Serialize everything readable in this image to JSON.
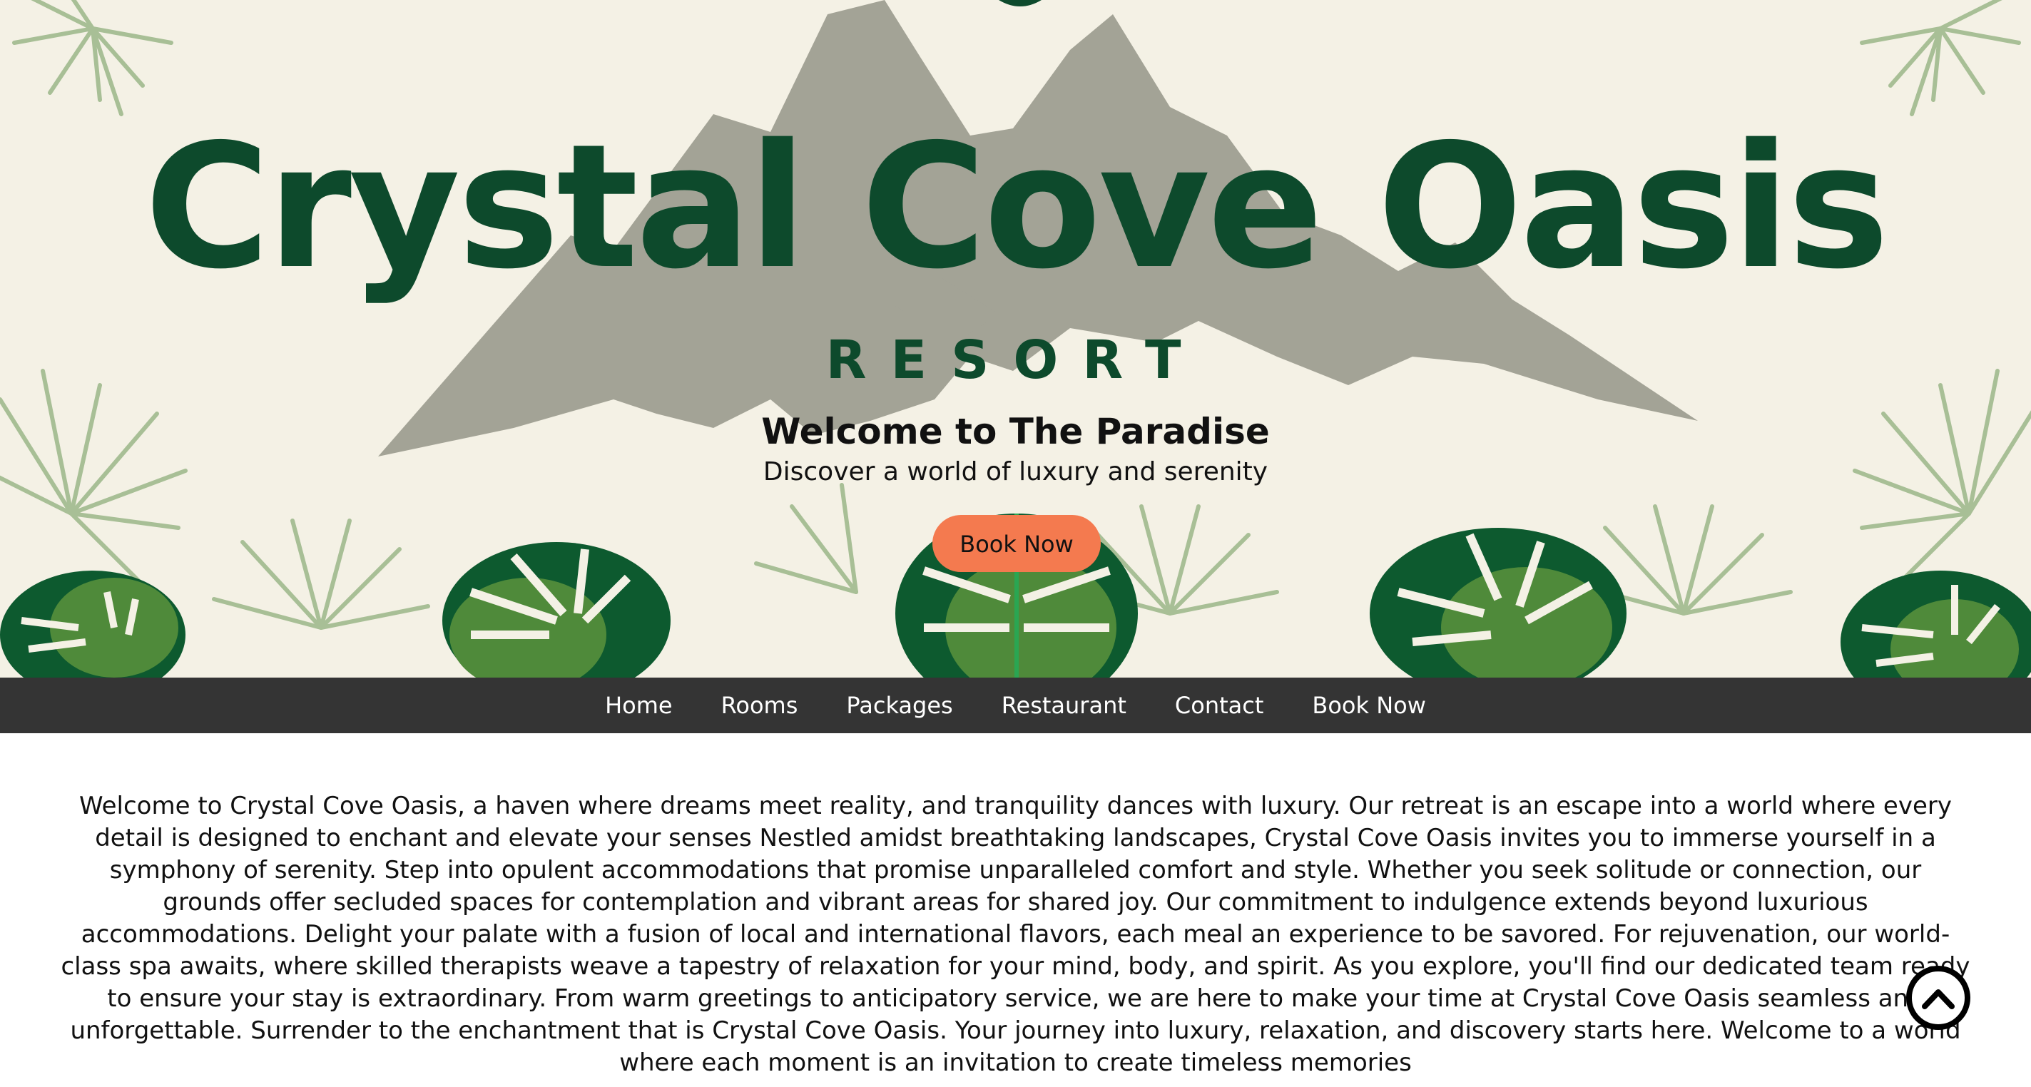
{
  "hero": {
    "title": "Crystal Cove Oasis",
    "subtitle": "RESORT",
    "heading": "Welcome to The Paradise",
    "tagline": "Discover a world of luxury and serenity",
    "cta_label": "Book Now"
  },
  "nav": {
    "items": [
      {
        "label": "Home"
      },
      {
        "label": "Rooms"
      },
      {
        "label": "Packages"
      },
      {
        "label": "Restaurant"
      },
      {
        "label": "Contact"
      },
      {
        "label": "Book Now"
      }
    ]
  },
  "main": {
    "intro": "Welcome to Crystal Cove Oasis, a haven where dreams meet reality, and tranquility dances with luxury. Our retreat is an escape into a world where every detail is designed to enchant and elevate your senses Nestled amidst breathtaking landscapes, Crystal Cove Oasis invites you to immerse yourself in a symphony of serenity. Step into opulent accommodations that promise unparalleled comfort and style. Whether you seek solitude or connection, our grounds offer secluded spaces for contemplation and vibrant areas for shared joy. Our commitment to indulgence extends beyond luxurious accommodations. Delight your palate with a fusion of local and international flavors, each meal an experience to be savored. For rejuvenation, our world-class spa awaits, where skilled therapists weave a tapestry of relaxation for your mind, body, and spirit. As you explore, you'll find our dedicated team ready to ensure your stay is extraordinary. From warm greetings to anticipatory service, we are here to make your time at Crystal Cove Oasis seamless and unforgettable. Surrender to the enchantment that is Crystal Cove Oasis. Your journey into luxury, relaxation, and discovery starts here. Welcome to a world where each moment is an invitation to create timeless memories"
  },
  "colors": {
    "hero_bg": "#f4f1e5",
    "brand_green": "#0d4a2c",
    "mountain": "#a3a396",
    "accent": "#f47a4f",
    "nav_bg": "#343434"
  },
  "icons": {
    "scroll_top": "chevron-up-circle-icon"
  }
}
